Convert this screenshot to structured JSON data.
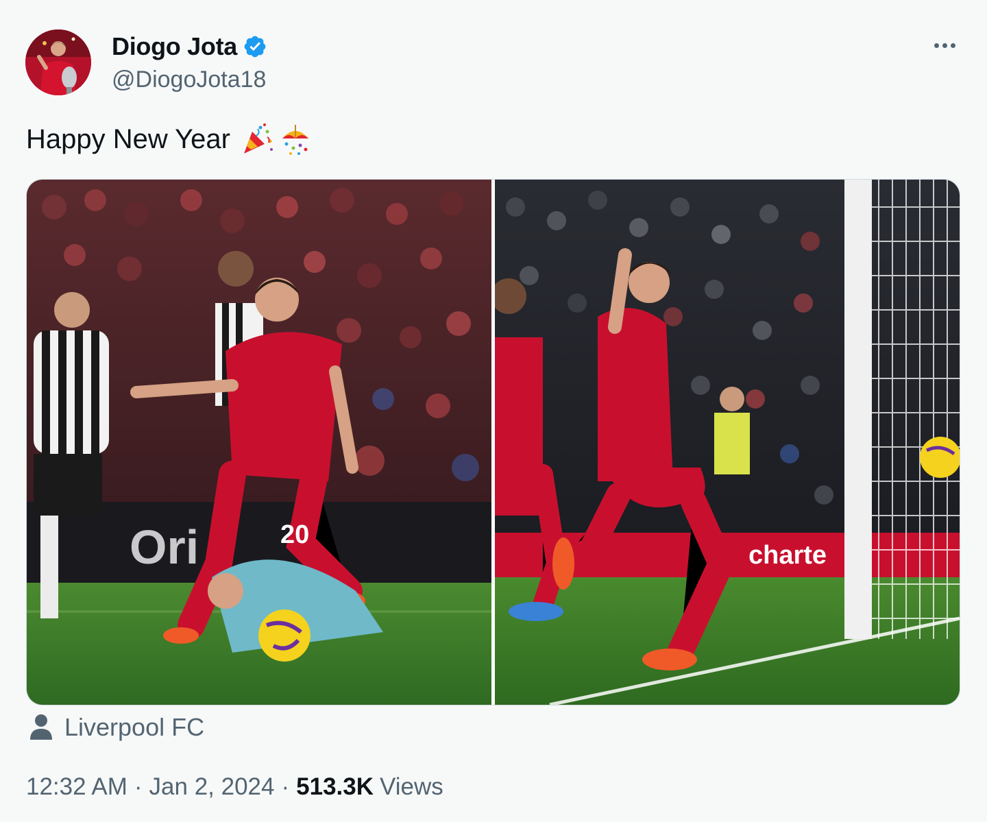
{
  "author": {
    "display_name": "Diogo Jota",
    "handle": "@DiogoJota18",
    "verified": true,
    "avatar_icon": "profile-photo",
    "verified_icon": "verified-badge-icon"
  },
  "more_menu_icon": "more-options-icon",
  "tweet": {
    "text": "Happy New Year",
    "emojis": [
      "party-popper-emoji",
      "confetti-ball-emoji"
    ]
  },
  "media": {
    "photos": [
      {
        "icon": "match-photo-jota-dribble"
      },
      {
        "icon": "match-photo-jota-celebration"
      }
    ]
  },
  "location": {
    "label": "Liverpool FC",
    "icon": "person-icon"
  },
  "meta": {
    "time": "12:32 AM",
    "separator": "·",
    "date": "Jan 2, 2024",
    "views_count": "513.3K",
    "views_label": "Views"
  },
  "colors": {
    "background": "#f7f9f9",
    "text_primary": "#0f1419",
    "text_secondary": "#536471",
    "verified_blue": "#1d9bf0",
    "liverpool_red": "#c8102e",
    "pitch_green": "#3f7a2a"
  }
}
